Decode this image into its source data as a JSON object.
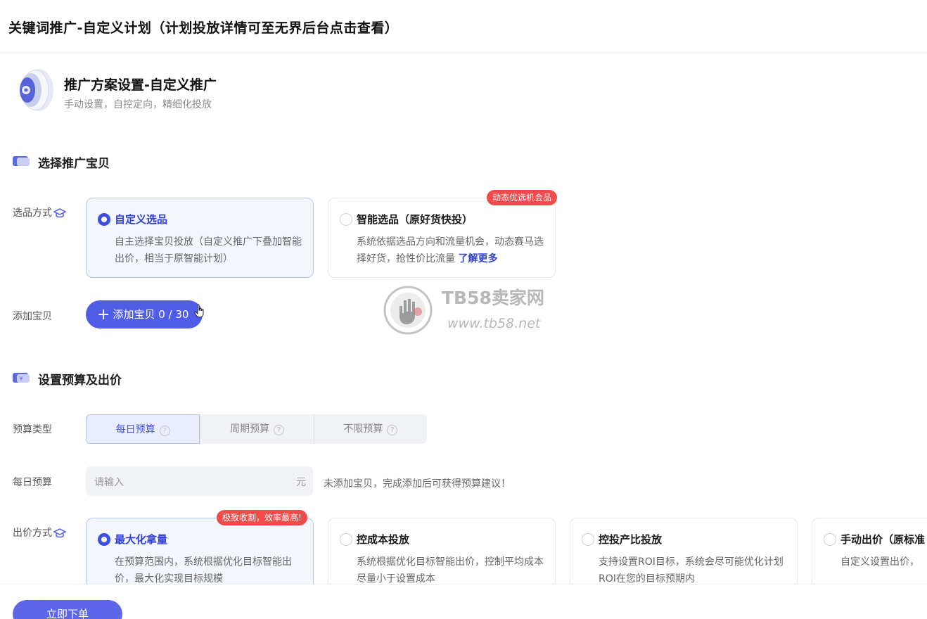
{
  "page": {
    "title": "关键词推广-自定义计划（计划投放详情可至无界后台点击查看）"
  },
  "plan": {
    "title": "推广方案设置-自定义推广",
    "subtitle": "手动设置，自控定向，精细化投放"
  },
  "select_section": {
    "title": "选择推广宝贝",
    "method_label": "选品方式",
    "options": [
      {
        "title": "自定义选品",
        "desc": "自主选择宝贝投放（自定义推广下叠加智能出价，相当于原智能计划）",
        "selected": true
      },
      {
        "title": "智能选品（原好货快投）",
        "desc": "系统依据选品方向和流量机会，动态赛马选择好货，抢性价比流量",
        "link": "了解更多",
        "badge": "动态优选机会品",
        "selected": false
      }
    ],
    "add_label": "添加宝贝",
    "add_button": "添加宝贝 0 / 30"
  },
  "watermark": {
    "name": "TB58卖家网",
    "url": "www.tb58.net"
  },
  "budget_section": {
    "title": "设置预算及出价",
    "type_label": "预算类型",
    "types": [
      "每日预算",
      "周期预算",
      "不限预算"
    ],
    "active_type": 0,
    "daily_label": "每日预算",
    "daily_placeholder": "请输入",
    "daily_unit": "元",
    "hint": "未添加宝贝，完成添加后可获得预算建议！",
    "bid_label": "出价方式",
    "bid_options": [
      {
        "title": "最大化拿量",
        "desc": "在预算范围内，系统根据优化目标智能出价，最大化实现目标规模",
        "badge": "极致收割，效率最高!",
        "selected": true
      },
      {
        "title": "控成本投放",
        "desc": "系统根据优化目标智能出价，控制平均成本尽量小于设置成本",
        "selected": false
      },
      {
        "title": "控投产比投放",
        "desc": "支持设置ROI目标，系统会尽可能优化计划ROI在您的目标预期内",
        "selected": false
      },
      {
        "title": "手动出价（原标准",
        "desc": "自定义设置出价，",
        "selected": false
      }
    ]
  },
  "footer": {
    "submit": "立即下单"
  },
  "colors": {
    "accent": "#3b4fe4",
    "badge": "#ef4b4b",
    "selected_bg": "#f4f6fe"
  }
}
